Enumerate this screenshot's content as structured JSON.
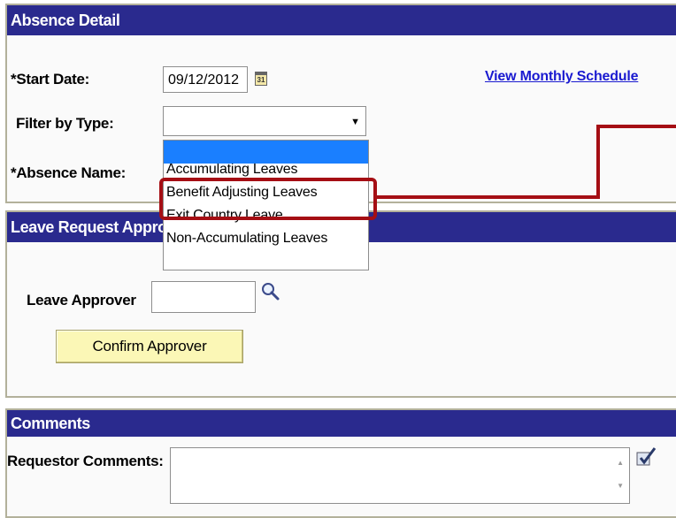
{
  "absence_detail": {
    "header": "Absence Detail",
    "start_date_label": "*Start Date:",
    "start_date_value": "09/12/2012",
    "calendar_icon_text": "31",
    "view_schedule_link": "View Monthly Schedule",
    "filter_label": "Filter by Type:",
    "filter_value": "",
    "absence_name_label": "*Absence Name:"
  },
  "filter_dropdown": {
    "options": [
      "",
      "Accumulating Leaves",
      "Benefit Adjusting Leaves",
      "Exit Country Leave",
      "Non-Accumulating Leaves"
    ],
    "selected_index": 0,
    "highlighted_option": "Benefit Adjusting Leaves"
  },
  "leave_request_approver": {
    "header": "Leave Request Approv",
    "approver_label": "Leave Approver",
    "approver_value": "",
    "confirm_button": "Confirm Approver"
  },
  "comments": {
    "header": "Comments",
    "requestor_label": "Requestor Comments:",
    "requestor_value": ""
  },
  "colors": {
    "header_bg": "#2a2a8e",
    "highlight": "#a50e14",
    "button_bg": "#fbf7b6",
    "link": "#1a1ad0",
    "selected_option": "#1a7fff"
  },
  "icons": [
    "calendar-icon",
    "dropdown-arrow-icon",
    "lookup-magnifier-icon",
    "spell-check-icon"
  ]
}
